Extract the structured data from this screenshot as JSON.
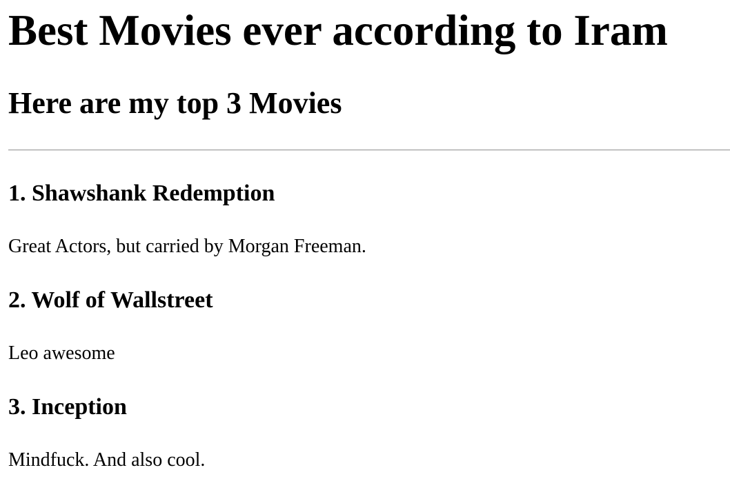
{
  "page": {
    "title": "Best Movies ever according to Iram",
    "subtitle": "Here are my top 3 Movies"
  },
  "movies": [
    {
      "title": "1. Shawshank Redemption",
      "note": "Great Actors, but carried by Morgan Freeman."
    },
    {
      "title": "2. Wolf of Wallstreet",
      "note": "Leo awesome"
    },
    {
      "title": "3. Inception",
      "note": "Mindfuck. And also cool."
    }
  ]
}
